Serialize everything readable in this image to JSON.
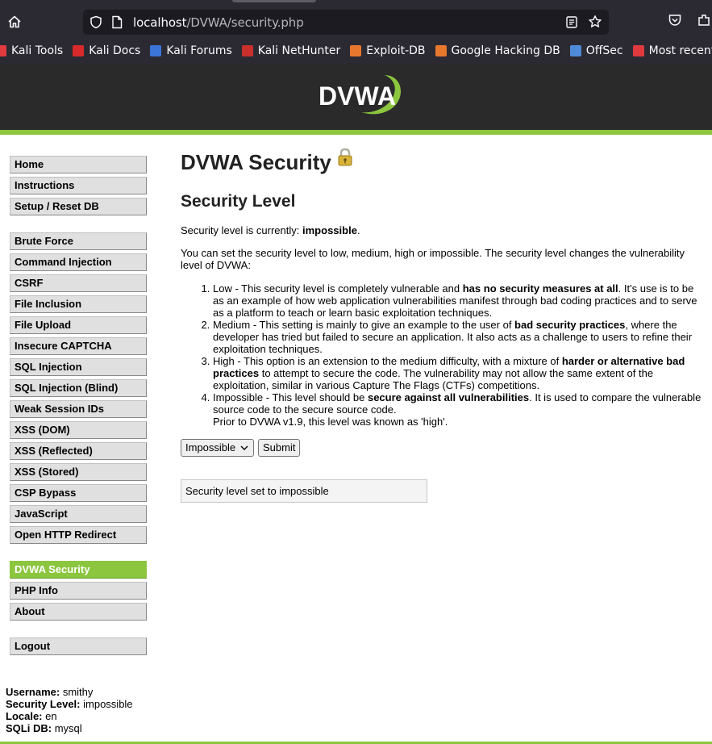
{
  "browser": {
    "url_host": "localhost",
    "url_path": "/DVWA/security.php",
    "bookmarks": [
      {
        "label": "Kali Tools",
        "color": "#e0393e"
      },
      {
        "label": "Kali Docs",
        "color": "#d82a2a"
      },
      {
        "label": "Kali Forums",
        "color": "#3a74d9"
      },
      {
        "label": "Kali NetHunter",
        "color": "#c9302c"
      },
      {
        "label": "Exploit-DB",
        "color": "#e8772e"
      },
      {
        "label": "Google Hacking DB",
        "color": "#e8772e"
      },
      {
        "label": "OffSec",
        "color": "#4f8ad8"
      },
      {
        "label": "Most recent entr",
        "color": "#e0393e"
      }
    ]
  },
  "header": {
    "logo_text": "DVWA"
  },
  "sidebar": {
    "group1": [
      {
        "label": "Home"
      },
      {
        "label": "Instructions"
      },
      {
        "label": "Setup / Reset DB"
      }
    ],
    "group2": [
      {
        "label": "Brute Force"
      },
      {
        "label": "Command Injection"
      },
      {
        "label": "CSRF"
      },
      {
        "label": "File Inclusion"
      },
      {
        "label": "File Upload"
      },
      {
        "label": "Insecure CAPTCHA"
      },
      {
        "label": "SQL Injection"
      },
      {
        "label": "SQL Injection (Blind)"
      },
      {
        "label": "Weak Session IDs"
      },
      {
        "label": "XSS (DOM)"
      },
      {
        "label": "XSS (Reflected)"
      },
      {
        "label": "XSS (Stored)"
      },
      {
        "label": "CSP Bypass"
      },
      {
        "label": "JavaScript"
      },
      {
        "label": "Open HTTP Redirect"
      }
    ],
    "group3": [
      {
        "label": "DVWA Security",
        "selected": true
      },
      {
        "label": "PHP Info"
      },
      {
        "label": "About"
      }
    ],
    "group4": [
      {
        "label": "Logout"
      }
    ]
  },
  "main": {
    "title": "DVWA Security",
    "subtitle": "Security Level",
    "current_prefix": "Security level is currently:",
    "current_level": "impossible",
    "current_suffix": ".",
    "intro": "You can set the security level to low, medium, high or impossible. The security level changes the vulnerability level of DVWA:",
    "levels": [
      {
        "pre": "Low - This security level is completely vulnerable and ",
        "bold": "has no security measures at all",
        "post": ". It's use is to be as an example of how web application vulnerabilities manifest through bad coding practices and to serve as a platform to teach or learn basic exploitation techniques.",
        "extra": ""
      },
      {
        "pre": "Medium - This setting is mainly to give an example to the user of ",
        "bold": "bad security practices",
        "post": ", where the developer has tried but failed to secure an application. It also acts as a challenge to users to refine their exploitation techniques.",
        "extra": ""
      },
      {
        "pre": "High - This option is an extension to the medium difficulty, with a mixture of ",
        "bold": "harder or alternative bad practices",
        "post": " to attempt to secure the code. The vulnerability may not allow the same extent of the exploitation, similar in various Capture The Flags (CTFs) competitions.",
        "extra": ""
      },
      {
        "pre": "Impossible - This level should be ",
        "bold": "secure against all vulnerabilities",
        "post": ". It is used to compare the vulnerable source code to the secure source code.",
        "extra": "Prior to DVWA v1.9, this level was known as 'high'."
      }
    ],
    "select_value": "Impossible",
    "submit_label": "Submit",
    "message": "Security level set to impossible"
  },
  "userinfo": {
    "username_label": "Username:",
    "username": "smithy",
    "security_label": "Security Level:",
    "security": "impossible",
    "locale_label": "Locale:",
    "locale": "en",
    "sqli_label": "SQLi DB:",
    "sqli": "mysql"
  }
}
